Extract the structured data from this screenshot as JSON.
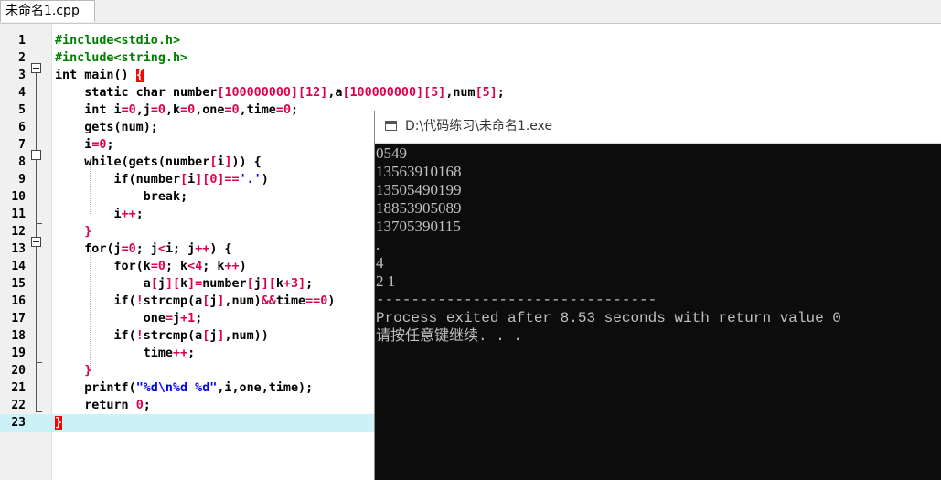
{
  "tab": {
    "label": "未命名1.cpp"
  },
  "editor": {
    "lines": [
      {
        "n": "1",
        "code": "<span class=\"pp\">#include&lt;stdio.h&gt;</span>"
      },
      {
        "n": "2",
        "code": "<span class=\"pp\">#include&lt;string.h&gt;</span>"
      },
      {
        "n": "3",
        "code": "<span class=\"kw\">int</span> main() <span class=\"hl\">{</span>"
      },
      {
        "n": "4",
        "code": "    <span class=\"kw\">static char</span> number<span class=\"op\">[</span><span class=\"num\">100000000</span><span class=\"op\">][</span><span class=\"num\">12</span><span class=\"op\">]</span>,a<span class=\"op\">[</span><span class=\"num\">100000000</span><span class=\"op\">][</span><span class=\"num\">5</span><span class=\"op\">]</span>,num<span class=\"op\">[</span><span class=\"num\">5</span><span class=\"op\">]</span>;"
      },
      {
        "n": "5",
        "code": "    <span class=\"kw\">int</span> i<span class=\"op\">=</span><span class=\"num\">0</span>,j<span class=\"op\">=</span><span class=\"num\">0</span>,k<span class=\"op\">=</span><span class=\"num\">0</span>,one<span class=\"op\">=</span><span class=\"num\">0</span>,time<span class=\"op\">=</span><span class=\"num\">0</span>;"
      },
      {
        "n": "6",
        "code": "    gets(num);"
      },
      {
        "n": "7",
        "code": "    i<span class=\"op\">=</span><span class=\"num\">0</span>;"
      },
      {
        "n": "8",
        "code": "    <span class=\"kw\">while</span>(gets(number<span class=\"op\">[</span>i<span class=\"op\">]</span>)) {"
      },
      {
        "n": "9",
        "code": "        <span class=\"kw\">if</span>(number<span class=\"op\">[</span>i<span class=\"op\">][</span><span class=\"num\">0</span><span class=\"op\">]==</span><span class=\"str\">'.'</span>)"
      },
      {
        "n": "10",
        "code": "            <span class=\"kw\">break</span>;"
      },
      {
        "n": "11",
        "code": "        i<span class=\"op\">++</span>;"
      },
      {
        "n": "12",
        "code": "    <span class=\"brk\">}</span>"
      },
      {
        "n": "13",
        "code": "    <span class=\"kw\">for</span>(j<span class=\"op\">=</span><span class=\"num\">0</span>; j<span class=\"op\">&lt;</span>i; j<span class=\"op\">++</span>) {"
      },
      {
        "n": "14",
        "code": "        <span class=\"kw\">for</span>(k<span class=\"op\">=</span><span class=\"num\">0</span>; k<span class=\"op\">&lt;</span><span class=\"num\">4</span>; k<span class=\"op\">++</span>)"
      },
      {
        "n": "15",
        "code": "            a<span class=\"op\">[</span>j<span class=\"op\">][</span>k<span class=\"op\">]=</span>number<span class=\"op\">[</span>j<span class=\"op\">][</span>k<span class=\"op\">+</span><span class=\"num\">3</span><span class=\"op\">]</span>;"
      },
      {
        "n": "16",
        "code": "        <span class=\"kw\">if</span>(<span class=\"op\">!</span>strcmp(a<span class=\"op\">[</span>j<span class=\"op\">]</span>,num)<span class=\"op\">&amp;&amp;</span>time<span class=\"op\">==</span><span class=\"num\">0</span>)"
      },
      {
        "n": "17",
        "code": "            one<span class=\"op\">=</span>j<span class=\"op\">+</span><span class=\"num\">1</span>;"
      },
      {
        "n": "18",
        "code": "        <span class=\"kw\">if</span>(<span class=\"op\">!</span>strcmp(a<span class=\"op\">[</span>j<span class=\"op\">]</span>,num))"
      },
      {
        "n": "19",
        "code": "            time<span class=\"op\">++</span>;"
      },
      {
        "n": "20",
        "code": "    <span class=\"brk\">}</span>"
      },
      {
        "n": "21",
        "code": "    printf(<span class=\"str\">\"%d\\n%d %d\"</span>,i,one,time);"
      },
      {
        "n": "22",
        "code": "    <span class=\"kw\">return</span> <span class=\"num\">0</span>;"
      },
      {
        "n": "23",
        "code": "<span class=\"hl\">}</span>"
      }
    ]
  },
  "console": {
    "title": "D:\\代码练习\\未命名1.exe",
    "output": [
      {
        "text": "0549",
        "style": "serif"
      },
      {
        "text": "13563910168",
        "style": "serif"
      },
      {
        "text": "13505490199",
        "style": "serif"
      },
      {
        "text": "18853905089",
        "style": "serif"
      },
      {
        "text": "13705390115",
        "style": "serif"
      },
      {
        "text": ".",
        "style": "serif"
      },
      {
        "text": "4",
        "style": "serif"
      },
      {
        "text": "2 1",
        "style": "serif"
      },
      {
        "text": "--------------------------------",
        "style": "mono"
      },
      {
        "text": "Process exited after 8.53 seconds with return value 0",
        "style": "mono"
      },
      {
        "text": "请按任意键继续. . .",
        "style": "mono"
      }
    ]
  }
}
